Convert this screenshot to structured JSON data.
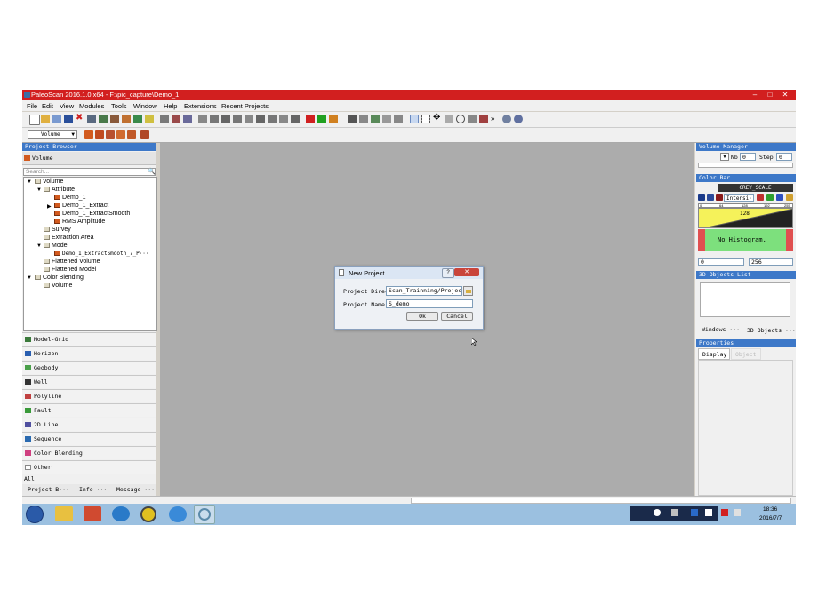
{
  "window": {
    "title": "PaleoScan 2016.1.0 x64 - F:\\pic_capture\\Demo_1",
    "controls": [
      "–",
      "□",
      "✕"
    ]
  },
  "menu": [
    "File",
    "Edit",
    "View",
    "Modules",
    "Tools",
    "Window",
    "Help",
    "Extensions",
    "Recent Projects"
  ],
  "toolbar2": {
    "volume_select": "Volume"
  },
  "project_browser": {
    "header": "Project Browser",
    "volume_tab": "Volume",
    "search_placeholder": "Search...",
    "tree": [
      {
        "label": "Volume",
        "level": 0,
        "expanded": true,
        "icon": "folder"
      },
      {
        "label": "Attribute",
        "level": 1,
        "expanded": true,
        "icon": "folder"
      },
      {
        "label": "Demo_1",
        "level": 2,
        "icon": "volume"
      },
      {
        "label": "Demo_1_Extract",
        "level": 2,
        "icon": "volume",
        "collapsed": true
      },
      {
        "label": "Demo_1_ExtractSmooth",
        "level": 2,
        "icon": "volume"
      },
      {
        "label": "RMS Amplitude",
        "level": 2,
        "icon": "volume"
      },
      {
        "label": "Survey",
        "level": 1,
        "icon": "folder"
      },
      {
        "label": "Extraction Area",
        "level": 1,
        "icon": "folder"
      },
      {
        "label": "Model",
        "level": 1,
        "expanded": true,
        "icon": "folder"
      },
      {
        "label": "Demo_1_ExtractSmooth_7_P···",
        "level": 2,
        "icon": "volume"
      },
      {
        "label": "Flattened Volume",
        "level": 1,
        "icon": "folder"
      },
      {
        "label": "Flattened Model",
        "level": 1,
        "icon": "folder"
      },
      {
        "label": "Color Blending",
        "level": 0,
        "expanded": true,
        "icon": "folder"
      },
      {
        "label": "Volume",
        "level": 1,
        "icon": "folder"
      }
    ],
    "accordion": [
      {
        "label": "Model-Grid",
        "icon": "grid-icon",
        "color": "#3b7a3b"
      },
      {
        "label": "Horizon",
        "icon": "horizon-icon",
        "color": "#2a5fb0"
      },
      {
        "label": "Geobody",
        "icon": "geobody-icon",
        "color": "#4aa04a"
      },
      {
        "label": "Well",
        "icon": "well-icon",
        "color": "#333333"
      },
      {
        "label": "Polyline",
        "icon": "polyline-icon",
        "color": "#c04040"
      },
      {
        "label": "Fault",
        "icon": "fault-icon",
        "color": "#3a9a3a"
      },
      {
        "label": "2D Line",
        "icon": "line2d-icon",
        "color": "#5050a0"
      },
      {
        "label": "Sequence",
        "icon": "sequence-icon",
        "color": "#2a6ab0"
      },
      {
        "label": "Color Blending",
        "icon": "color-blending-icon",
        "color": "#d04080"
      },
      {
        "label": "Other",
        "icon": "other-icon",
        "color": "#888888"
      }
    ],
    "all_label": "All",
    "bottom_tabs": [
      "Project B···",
      "Info ···",
      "Message ···"
    ]
  },
  "volume_manager": {
    "header": "Volume Manager",
    "nb_label": "Nb",
    "nb_value": "0",
    "step_label": "Step",
    "step_value": "0"
  },
  "color_bar": {
    "header": "Color Bar",
    "preset": "GREY_SCALE",
    "mode": "Intensi···",
    "ticks": [
      "0",
      "64",
      "128",
      "192",
      "255"
    ],
    "mid_value": "128",
    "histogram_text": "No Histogram.",
    "min": "0",
    "max": "256",
    "colors": {
      "ramp_bg": "#f5f25a",
      "hist_bg": "#7de07d",
      "hist_edge": "#e05050"
    }
  },
  "objects_list": {
    "header": "3D Objects List",
    "tabs": [
      "Windows ···",
      "3D Objects ···"
    ]
  },
  "properties": {
    "header": "Properties",
    "tabs": [
      "Display",
      "Object"
    ]
  },
  "dialog": {
    "title": "New Project",
    "dir_label": "Project Direc",
    "dir_value": "Scan_Trainning/Projects",
    "name_label": "Project Name",
    "name_value": "S_demo",
    "ok": "Ok",
    "cancel": "Cancel"
  },
  "taskbar": {
    "time": "18:36",
    "date": "2016/7/7"
  }
}
